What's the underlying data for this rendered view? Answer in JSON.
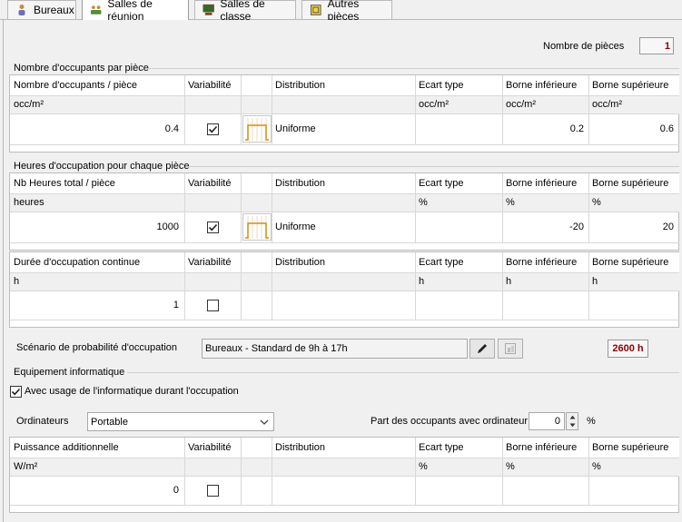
{
  "tabs": [
    {
      "label": "Bureaux",
      "icon": "person-icon"
    },
    {
      "label": "Salles de réunion",
      "icon": "meeting-icon"
    },
    {
      "label": "Salles de classe",
      "icon": "classroom-icon"
    },
    {
      "label": "Autres pièces",
      "icon": "rooms-icon"
    }
  ],
  "rooms_count": {
    "label": "Nombre de pièces",
    "value": "1"
  },
  "occupants_section": {
    "title": "Nombre d'occupants par pièce",
    "headers": [
      "Nombre d'occupants / pièce",
      "Variabilité",
      "",
      "Distribution",
      "Ecart type",
      "Borne inférieure",
      "Borne supérieure"
    ],
    "units": [
      "occ/m²",
      "",
      "",
      "",
      "occ/m²",
      "occ/m²",
      "occ/m²"
    ],
    "row": {
      "value": "0.4",
      "variability": true,
      "distribution": "Uniforme",
      "std": "",
      "lower": "0.2",
      "upper": "0.6"
    }
  },
  "hours_section": {
    "title": "Heures d'occupation pour chaque pièce",
    "headers": [
      "Nb Heures total / pièce",
      "Variabilité",
      "",
      "Distribution",
      "Ecart type",
      "Borne inférieure",
      "Borne supérieure"
    ],
    "units": [
      "heures",
      "",
      "",
      "",
      "%",
      "%",
      "%"
    ],
    "row": {
      "value": "1000",
      "variability": true,
      "distribution": "Uniforme",
      "std": "",
      "lower": "-20",
      "upper": "20"
    }
  },
  "duration_section": {
    "headers": [
      "Durée d'occupation continue",
      "Variabilité",
      "",
      "Distribution",
      "Ecart type",
      "Borne inférieure",
      "Borne supérieure"
    ],
    "units": [
      "h",
      "",
      "",
      "",
      "h",
      "h",
      "h"
    ],
    "row": {
      "value": "1",
      "variability": false,
      "distribution": "",
      "std": "",
      "lower": "",
      "upper": ""
    }
  },
  "scenario": {
    "label": "Scénario de probabilité d'occupation",
    "value": "Bureaux - Standard de 9h à 17h",
    "total": "2600 h"
  },
  "it_section": {
    "title": "Equipement informatique",
    "checkbox_label": "Avec usage de l'informatique durant l'occupation",
    "checkbox_checked": true,
    "computers_label": "Ordinateurs",
    "computers_value": "Portable",
    "share_label": "Part des occupants avec ordinateur",
    "share_value": "0",
    "share_unit": "%",
    "headers": [
      "Puissance additionnelle",
      "Variabilité",
      "",
      "Distribution",
      "Ecart type",
      "Borne inférieure",
      "Borne supérieure"
    ],
    "units": [
      "W/m²",
      "",
      "",
      "",
      "%",
      "%",
      "%"
    ],
    "row": {
      "value": "0",
      "variability": false
    }
  },
  "colors": {
    "accent_red": "#8b0000",
    "distribution_orange": "#e08a00"
  }
}
